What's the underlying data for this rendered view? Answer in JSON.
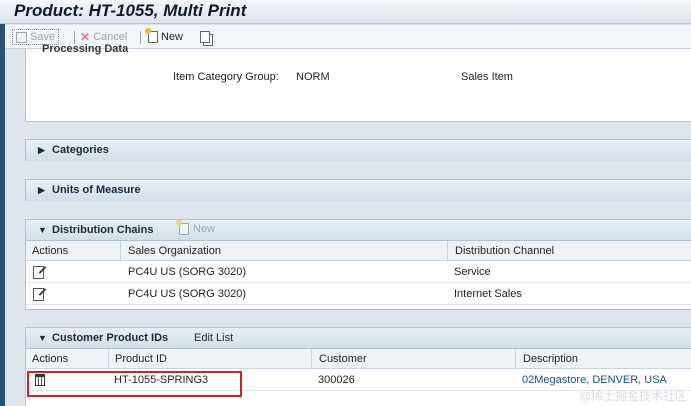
{
  "title": "Product: HT-1055, Multi Print",
  "toolbar": {
    "save": "Save",
    "cancel": "Cancel",
    "new": "New"
  },
  "processing": {
    "section_title": "Processing Data",
    "item_category_group_label": "Item Category Group:",
    "item_category_group_value": "NORM",
    "item_category_text": "Sales Item"
  },
  "categories": {
    "title": "Categories"
  },
  "units": {
    "title": "Units of Measure"
  },
  "distribution": {
    "title": "Distribution Chains",
    "new_label": "New",
    "columns": [
      "Actions",
      "Sales Organization",
      "Distribution Channel"
    ],
    "rows": [
      {
        "sales_org": "PC4U US (SORG 3020)",
        "channel": "Service"
      },
      {
        "sales_org": "PC4U US (SORG 3020)",
        "channel": "Internet Sales"
      }
    ]
  },
  "customer_ids": {
    "title": "Customer Product IDs",
    "edit_list": "Edit List",
    "columns": [
      "Actions",
      "Product ID",
      "Customer",
      "Description"
    ],
    "rows": [
      {
        "product_id": "HT-1055-SPRING3",
        "customer": "300026",
        "description": "02Megastore, DENVER, USA"
      }
    ]
  },
  "watermark": "@稀土掘金技术社区",
  "colors": {
    "highlight": "#d0231f",
    "link": "#1a4f8f",
    "header": "#d3dee9"
  }
}
